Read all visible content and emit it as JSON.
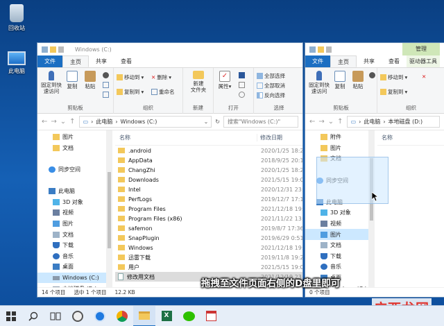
{
  "desktop": {
    "icons": [
      {
        "label": "回收站"
      },
      {
        "label": "此电脑"
      }
    ]
  },
  "window_left": {
    "title": "Windows (C:)",
    "tabs": [
      "文件",
      "主页",
      "共享",
      "查看"
    ],
    "ribbon": {
      "pin_label": "固定到快\n速访问",
      "copy_label": "复制",
      "paste_label": "粘贴",
      "clipboard_caption": "剪贴板",
      "move_to_label": "移动到",
      "copy_to_label": "复制到",
      "delete_label": "删除",
      "rename_label": "重命名",
      "organize_caption": "组织",
      "new_folder_label": "新建\n文件夹",
      "new_caption": "新建",
      "properties_label": "属性",
      "open_caption": "打开",
      "select_all_label": "全部选择",
      "select_none_label": "全部取消",
      "invert_label": "反向选择",
      "select_caption": "选择"
    },
    "address": {
      "crumbs": [
        "此电脑",
        "Windows (C:)"
      ],
      "search_placeholder": "搜索\"Windows (C:)\""
    },
    "nav": [
      {
        "label": "图片",
        "type": "folder"
      },
      {
        "label": "文档",
        "type": "folder"
      },
      {
        "label": "",
        "type": "blank"
      },
      {
        "label": "同步空间",
        "type": "cloud"
      },
      {
        "label": "",
        "type": "blank"
      },
      {
        "label": "此电脑",
        "type": "pc"
      },
      {
        "label": "3D 对象",
        "type": "cube"
      },
      {
        "label": "视频",
        "type": "video"
      },
      {
        "label": "图片",
        "type": "pic"
      },
      {
        "label": "文档",
        "type": "doc"
      },
      {
        "label": "下载",
        "type": "down"
      },
      {
        "label": "音乐",
        "type": "music"
      },
      {
        "label": "桌面",
        "type": "desk"
      },
      {
        "label": "Windows (C:)",
        "type": "drive",
        "selected": true
      },
      {
        "label": "本地磁盘 (D:)",
        "type": "drive"
      }
    ],
    "columns": {
      "name": "名称",
      "date": "修改日期"
    },
    "files": [
      {
        "name": ".android",
        "date": "2020/1/25 18:28"
      },
      {
        "name": "AppData",
        "date": "2018/9/25 20:14"
      },
      {
        "name": "ChangZhi",
        "date": "2020/1/25 18:24"
      },
      {
        "name": "Downloads",
        "date": "2021/5/15 19:09"
      },
      {
        "name": "Intel",
        "date": "2020/12/31 23:0"
      },
      {
        "name": "PerfLogs",
        "date": "2019/12/7 17:14"
      },
      {
        "name": "Program Files",
        "date": "2021/12/18 19:4"
      },
      {
        "name": "Program Files (x86)",
        "date": "2021/11/22 13:5"
      },
      {
        "name": "safemon",
        "date": "2019/8/7 17:36"
      },
      {
        "name": "SnapPlugin",
        "date": "2019/6/29 0:51"
      },
      {
        "name": "Windows",
        "date": "2021/12/18 19:4"
      },
      {
        "name": "迅雷下载",
        "date": "2019/11/8 19:22"
      },
      {
        "name": "用户",
        "date": "2021/5/15 19:03"
      },
      {
        "name": "修改用文档",
        "date": "2021/12/19 23:"
      }
    ],
    "status": {
      "count": "14 个项目",
      "selected": "选中 1 个项目",
      "size": "12.2 KB"
    }
  },
  "window_right": {
    "manage_label": "管理",
    "tabs": [
      "文件",
      "主页",
      "共享",
      "查看",
      "驱动器工具"
    ],
    "ribbon": {
      "pin_label": "固定到快\n速访问",
      "copy_label": "复制",
      "paste_label": "粘贴",
      "clipboard_caption": "剪贴板",
      "move_to_label": "移动到",
      "copy_to_label": "复制到",
      "organize_caption": "组织"
    },
    "address": {
      "crumbs": [
        "此电脑",
        "本地磁盘 (D:)"
      ]
    },
    "nav": [
      {
        "label": "附件",
        "type": "folder"
      },
      {
        "label": "图片",
        "type": "folder"
      },
      {
        "label": "文档",
        "type": "folder"
      },
      {
        "label": "",
        "type": "blank"
      },
      {
        "label": "同步空间",
        "type": "cloud"
      },
      {
        "label": "",
        "type": "blank"
      },
      {
        "label": "此电脑",
        "type": "pc"
      },
      {
        "label": "3D 对象",
        "type": "cube"
      },
      {
        "label": "视频",
        "type": "video"
      },
      {
        "label": "图片",
        "type": "pic",
        "selected": true
      },
      {
        "label": "文档",
        "type": "doc"
      },
      {
        "label": "下载",
        "type": "down"
      },
      {
        "label": "音乐",
        "type": "music"
      },
      {
        "label": "桌面",
        "type": "desk"
      },
      {
        "label": "Windows (C:)",
        "type": "drive"
      },
      {
        "label": "本地磁盘 (D:)",
        "type": "drive"
      }
    ],
    "columns": {
      "name": "名称"
    },
    "status": {
      "count": "0 个项目"
    }
  },
  "caption": "拖拽至文件页面右侧的D盘里即可",
  "watermark": "广西龙网",
  "taskbar": {
    "icons": [
      "task-view-icon",
      "clock-app-icon",
      "search-app-icon",
      "chrome-icon",
      "file-explorer-icon",
      "excel-icon",
      "wechat-icon",
      "app-icon"
    ]
  },
  "colors": {
    "accent": "#1b6ec2",
    "manage_tab": "#cfe7b8",
    "selection": "#cce8ff",
    "folder": "#f3c85b"
  }
}
